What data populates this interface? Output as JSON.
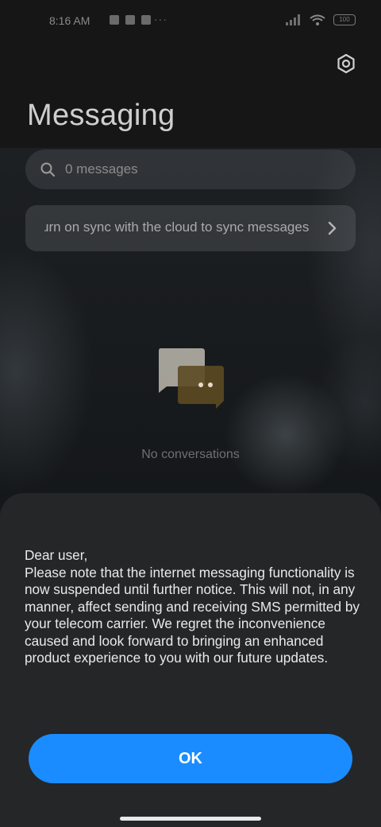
{
  "status_bar": {
    "time": "8:16 AM",
    "battery": "100",
    "more_dots": "···"
  },
  "header": {
    "title": "Messaging"
  },
  "search": {
    "placeholder": "0 messages"
  },
  "sync_banner": {
    "text": "urn on sync with the cloud to sync messages"
  },
  "empty_state": {
    "text": "No conversations"
  },
  "dialog": {
    "greeting": "Dear user,",
    "body": "Please note that the internet messaging functionality is now suspended until further notice. This will not, in any manner, affect sending and receiving SMS permitted by your telecom carrier. We regret the inconvenience caused and look forward to bringing an enhanced product experience to you with our future updates.",
    "ok_label": "OK"
  },
  "colors": {
    "accent": "#1a8cff",
    "sheet": "#252628",
    "background": "#161616"
  },
  "icons": [
    "settings-icon",
    "search-icon",
    "chevron-right-icon",
    "chat-bubbles-icon",
    "wifi-icon",
    "signal-icon",
    "battery-icon"
  ]
}
